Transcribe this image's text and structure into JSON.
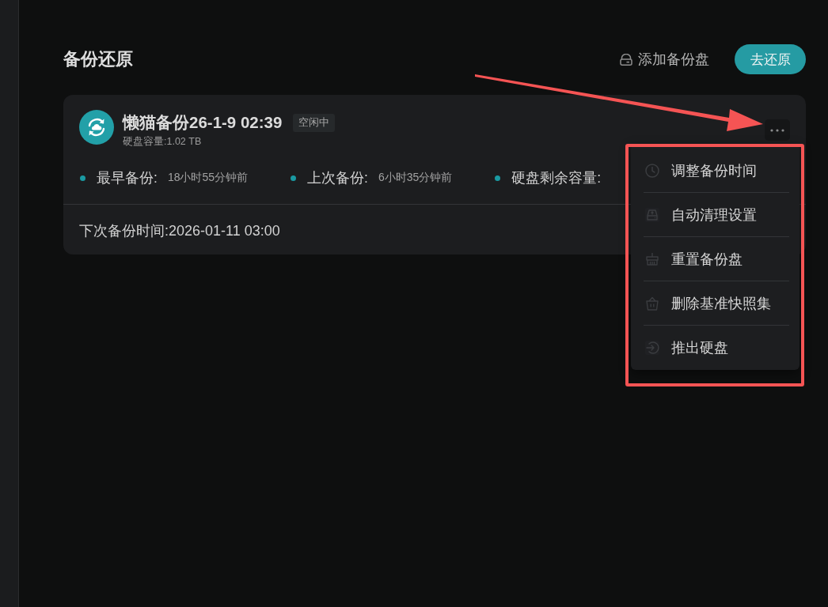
{
  "page": {
    "title": "备份还原",
    "add_disk_link": "添加备份盘",
    "restore_button": "去还原"
  },
  "backup_card": {
    "name": "懒猫备份26-1-9 02:39",
    "status": "空闲中",
    "capacity": "硬盘容量:1.02 TB",
    "stats": [
      {
        "label": "最早备份:",
        "value": "18小时55分钟前"
      },
      {
        "label": "上次备份:",
        "value": "6小时35分钟前"
      },
      {
        "label": "硬盘剩余容量:"
      }
    ],
    "next_backup": "下次备份时间:2026-01-11 03:00"
  },
  "menu": {
    "expanded": true,
    "items": [
      {
        "label": "调整备份时间"
      },
      {
        "label": "自动清理设置"
      },
      {
        "label": "重置备份盘"
      },
      {
        "label": "删除基准快照集"
      },
      {
        "label": "推出硬盘"
      }
    ]
  }
}
